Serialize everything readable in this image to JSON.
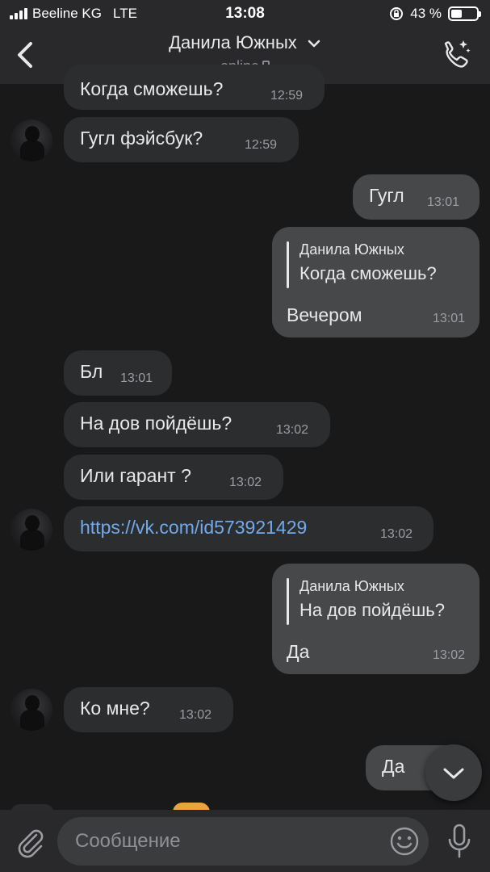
{
  "status_bar": {
    "carrier": "Beeline KG",
    "network": "LTE",
    "time": "13:08",
    "battery": "43 %",
    "battery_level": 0.43
  },
  "header": {
    "contact_name": "Данила Южных",
    "status": "online"
  },
  "messages": [
    {
      "text": "Когда сможешь?",
      "time": "12:59"
    },
    {
      "text": "Гугл фэйсбук?",
      "time": "12:59"
    },
    {
      "text": "Гугл",
      "time": "13:01"
    },
    {
      "quote_name": "Данила Южных",
      "quote_text": "Когда сможешь?",
      "text": "Вечером",
      "time": "13:01"
    },
    {
      "text": "Бл",
      "time": "13:01"
    },
    {
      "text": "На дов пойдёшь?",
      "time": "13:02"
    },
    {
      "text": "Или гарант ?",
      "time": "13:02"
    },
    {
      "text": "https://vk.com/id573921429",
      "time": "13:02"
    },
    {
      "quote_name": "Данила Южных",
      "quote_text": "На дов пойдёшь?",
      "text": "Да",
      "time": "13:02"
    },
    {
      "text": "Ко мне?",
      "time": "13:02"
    },
    {
      "text": "Да"
    }
  ],
  "composer": {
    "placeholder": "Сообщение"
  },
  "colors": {
    "background": "#19191a",
    "incoming_bubble": "#2c2d2f",
    "outgoing_bubble": "#47484a",
    "link": "#71aaeb"
  },
  "icons": [
    "back-arrow-icon",
    "chevron-down-icon",
    "call-icon",
    "paperclip-icon",
    "emoji-icon",
    "microphone-icon",
    "scroll-down-chevron-icon"
  ]
}
